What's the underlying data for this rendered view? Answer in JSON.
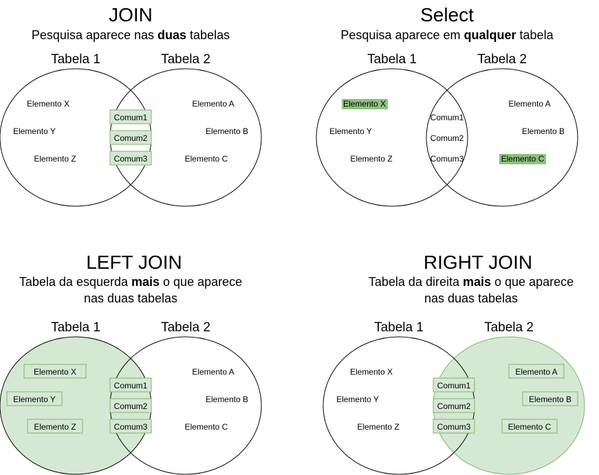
{
  "join": {
    "title": "JOIN",
    "subtitle_pre": "Pesquisa aparece nas ",
    "subtitle_bold": "duas",
    "subtitle_post": " tabelas",
    "table1": "Tabela 1",
    "table2": "Tabela 2",
    "left": [
      "Elemento  X",
      "Elemento  Y",
      "Elemento  Z"
    ],
    "common": [
      "Comum1",
      "Comum2",
      "Comum3"
    ],
    "right": [
      "Elemento  A",
      "Elemento  B",
      "Elemento  C"
    ]
  },
  "select": {
    "title": "Select",
    "subtitle_pre": "Pesquisa aparece em ",
    "subtitle_bold": "qualquer",
    "subtitle_post": " tabela",
    "table1": "Tabela 1",
    "table2": "Tabela 2",
    "left": [
      "Elemento  X",
      "Elemento  Y",
      "Elemento  Z"
    ],
    "common": [
      "Comum1",
      "Comum2",
      "Comum3"
    ],
    "right": [
      "Elemento  A",
      "Elemento  B",
      "Elemento  C"
    ]
  },
  "left_join": {
    "title": "LEFT JOIN",
    "subtitle_line1_pre": "Tabela da esquerda ",
    "subtitle_line1_bold": "mais",
    "subtitle_line1_post": " o que aparece",
    "subtitle_line2": "nas duas tabelas",
    "table1": "Tabela 1",
    "table2": "Tabela 2",
    "left": [
      "Elemento  X",
      "Elemento  Y",
      "Elemento  Z"
    ],
    "common": [
      "Comum1",
      "Comum2",
      "Comum3"
    ],
    "right": [
      "Elemento  A",
      "Elemento  B",
      "Elemento  C"
    ]
  },
  "right_join": {
    "title": "RIGHT JOIN",
    "subtitle_line1_pre": "Tabela da direita ",
    "subtitle_line1_bold": "mais",
    "subtitle_line1_post": " o que aparece",
    "subtitle_line2": "nas duas tabelas",
    "table1": "Tabela 1",
    "table2": "Tabela 2",
    "left": [
      "Elemento  X",
      "Elemento  Y",
      "Elemento  Z"
    ],
    "common": [
      "Comum1",
      "Comum2",
      "Comum3"
    ],
    "right": [
      "Elemento  A",
      "Elemento  B",
      "Elemento  C"
    ]
  },
  "colors": {
    "highlight_fill": "#d5e8d4",
    "highlight_stroke": "#82b366",
    "selected_fill": "#8cc17e"
  }
}
